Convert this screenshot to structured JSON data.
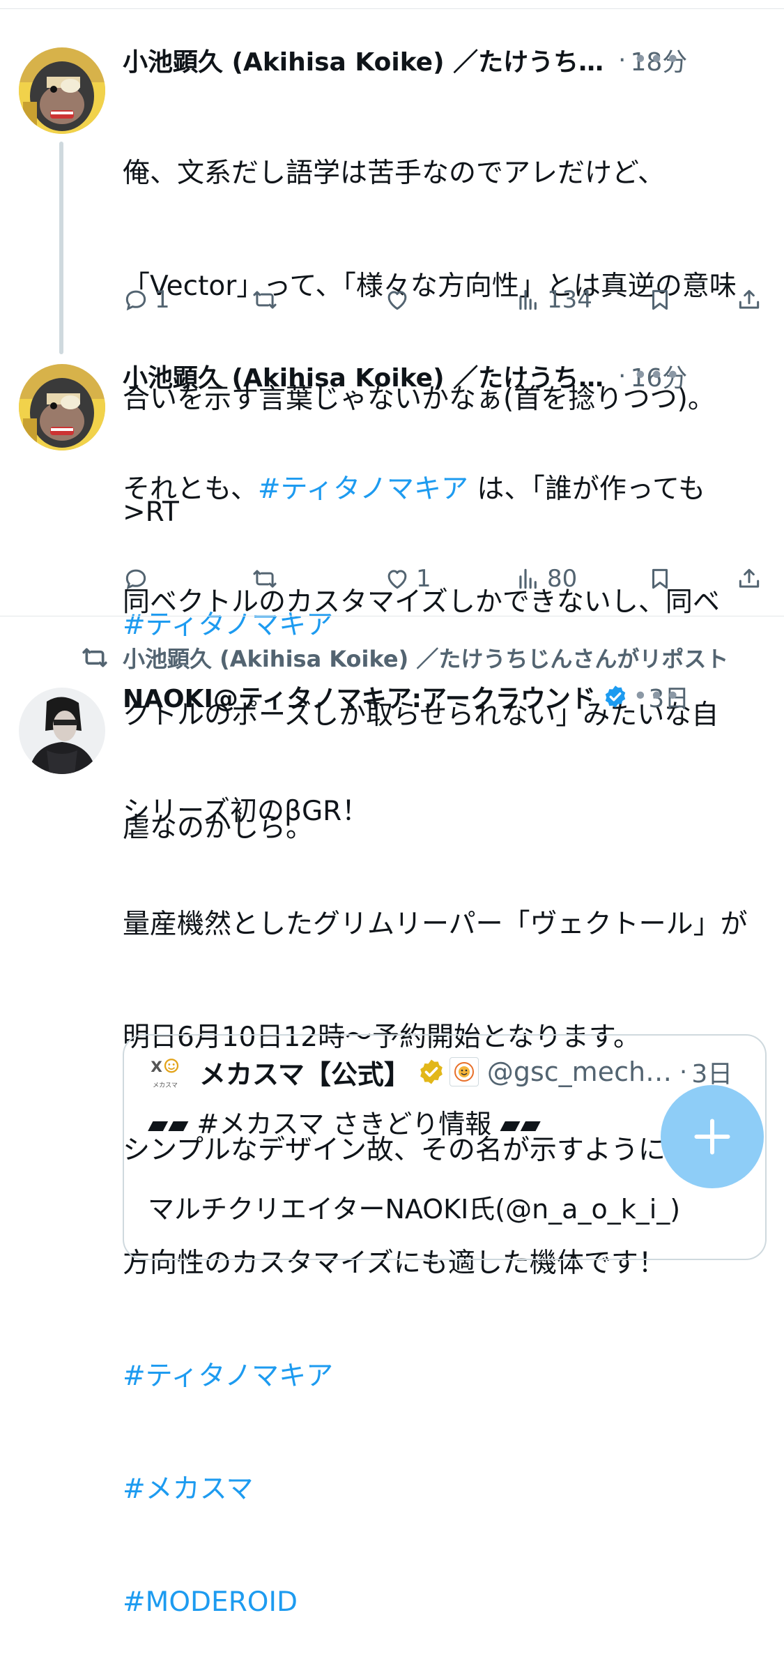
{
  "tweets": [
    {
      "name": "小池顕久 (Akihisa Koike) ／たけうちじんさん",
      "time": "18分",
      "more": "•••",
      "body_lines": [
        "俺、文系だし語学は苦手なのでアレだけど、",
        "「Vector」って、「様々な方向性」とは真逆の意味",
        "合いを示す言葉じゃないかなぁ(首を捻りつつ)。",
        ">RT"
      ],
      "hashtag": "#ティタノマキア",
      "reply_count": "1",
      "retweet_count": "",
      "like_count": "",
      "view_count": "134"
    },
    {
      "name": "小池顕久 (Akihisa Koike) ／たけうちじんさん",
      "time": "16分",
      "more": "•••",
      "body_prefix": "それとも、",
      "body_hashtag": "#ティタノマキア",
      "body_rest_first": " は、「誰が作っても",
      "body_lines": [
        "同ベクトルのカスタマイズしかできないし、同ベ",
        "クトルのポーズしか取らせられない」みたいな自",
        "虐なのかしら。"
      ],
      "reply_count": "",
      "retweet_count": "",
      "like_count": "1",
      "view_count": "80"
    }
  ],
  "repost": {
    "label": "小池顕久 (Akihisa Koike) ／たけうちじんさんがリポスト",
    "name": "NAOKI@ティタノマキア:アークラウンド",
    "time": "3日",
    "more": "•••",
    "body_lines": [
      "シリーズ初のβGR！",
      "量産機然としたグリムリーパー「ヴェクトール」が",
      "明日6月10日12時〜予約開始となります。",
      "シンプルなデザイン故、その名が示すように様々な",
      "方向性のカスタマイズにも適した機体です！"
    ],
    "hashtags": [
      "#ティタノマキア",
      "#メカスマ",
      "#MODEROID"
    ]
  },
  "quote": {
    "logo_text": "メカスマ",
    "name": "メカスマ【公式】",
    "handle": "@gsc_mechasuma",
    "time": "3日",
    "line1": "▰▰ #メカスマ さきどり情報 ▰▰",
    "line2": "マルチクリエイターNAOKI氏(@n_a_o_k_i_)"
  },
  "colors": {
    "accent": "#1d9bf0",
    "text": "#0f1419",
    "secondary": "#536471",
    "fab": "#8ecdf7",
    "gold": "#e2b719"
  },
  "icons": {
    "reply": "reply-icon",
    "retweet": "retweet-icon",
    "like": "heart-icon",
    "views": "views-icon",
    "bookmark": "bookmark-icon",
    "share": "share-icon",
    "compose": "plus-icon"
  }
}
